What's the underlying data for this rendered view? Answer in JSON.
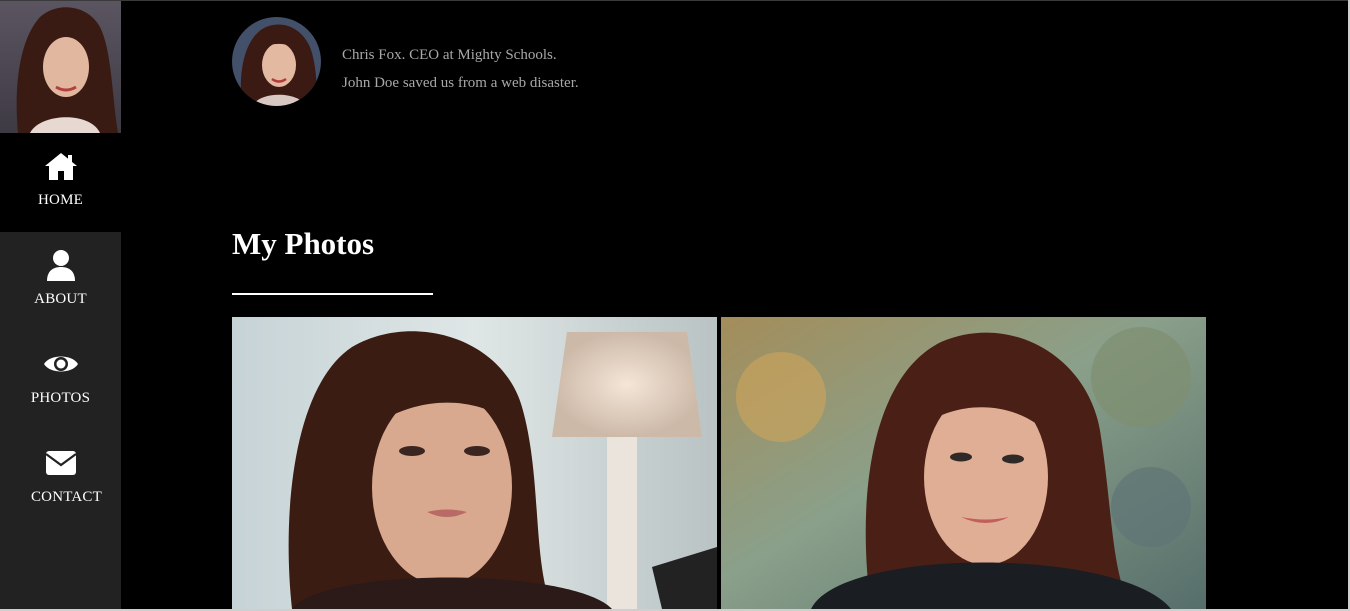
{
  "sidebar": {
    "avatar": {
      "icon": "profile-photo"
    },
    "items": [
      {
        "label": "HOME",
        "icon": "home-icon",
        "active": true
      },
      {
        "label": "ABOUT",
        "icon": "user-icon",
        "active": false
      },
      {
        "label": "PHOTOS",
        "icon": "eye-icon",
        "active": false
      },
      {
        "label": "CONTACT",
        "icon": "envelope-icon",
        "active": false
      }
    ]
  },
  "testimonial": {
    "author": "Chris Fox. CEO at Mighty Schools.",
    "quote": "John Doe saved us from a web disaster."
  },
  "photos": {
    "title": "My Photos",
    "items": [
      {
        "image": "photo-woman-indoor"
      },
      {
        "image": "photo-woman-outdoor"
      }
    ]
  },
  "colors": {
    "background": "#000000",
    "sidebar": "#222222",
    "text": "#ffffff",
    "muted_text": "#a8a8a8"
  }
}
